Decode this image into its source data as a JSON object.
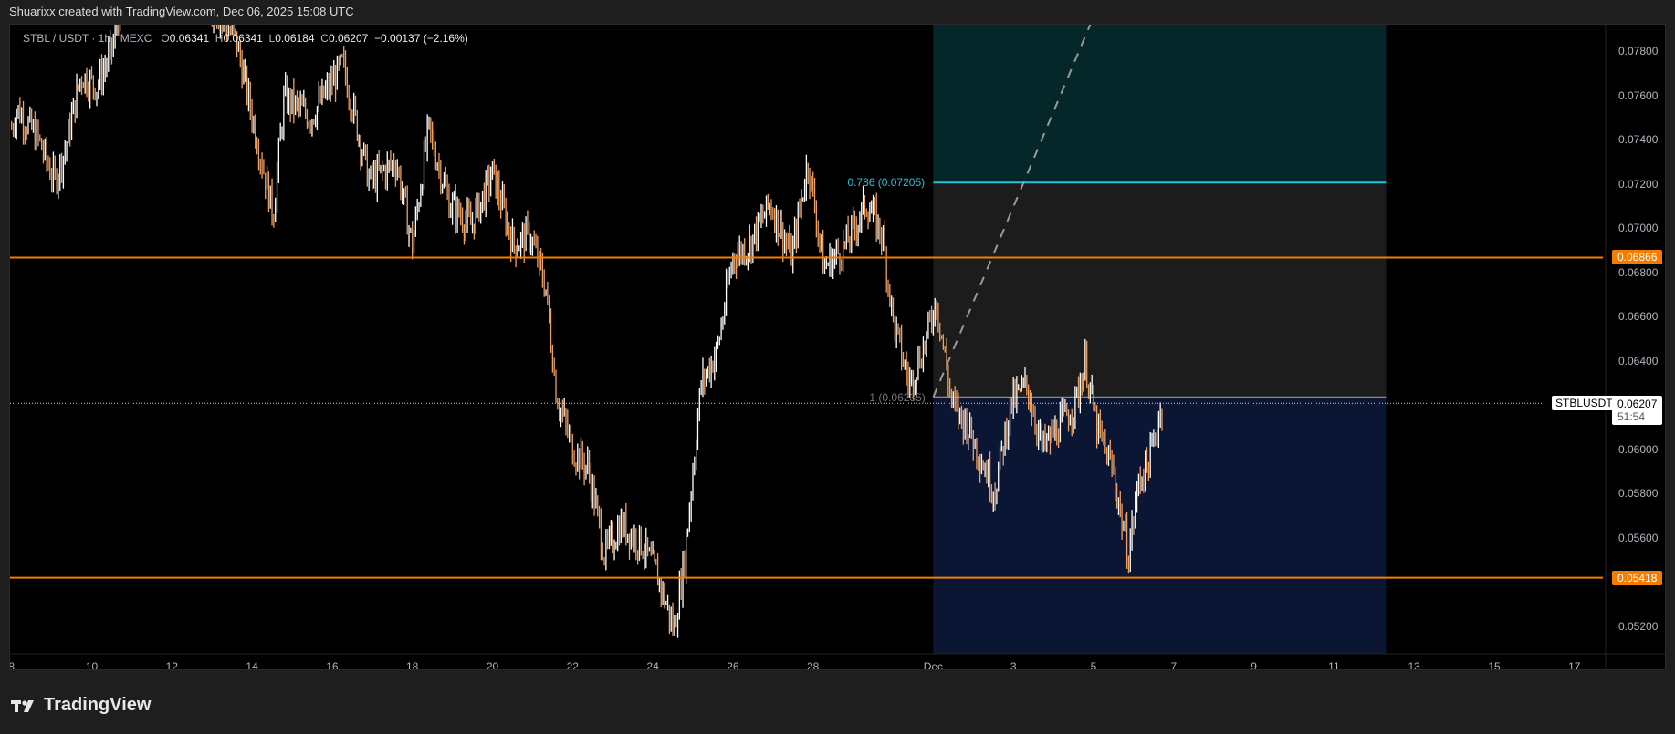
{
  "header": {
    "attribution": "Shuarixx created with TradingView.com, Dec 06, 2025 15:08 UTC"
  },
  "legend": {
    "symbol": "STBL / USDT · 1h · MEXC",
    "open_label": "O",
    "open": "0.06341",
    "high_label": "H",
    "high": "0.06341",
    "low_label": "L",
    "low": "0.06184",
    "close_label": "C",
    "close": "0.06207",
    "change": "−0.00137 (−2.16%)"
  },
  "price_axis": {
    "ticks": [
      "0.07800",
      "0.07600",
      "0.07400",
      "0.07200",
      "0.07000",
      "0.06800",
      "0.06600",
      "0.06400",
      "0.06000",
      "0.05800",
      "0.05600",
      "0.05200"
    ],
    "levels": [
      {
        "label": "0.06866",
        "value": 0.06866
      },
      {
        "label": "0.05418",
        "value": 0.05418
      }
    ],
    "current": {
      "symbol": "STBLUSDT",
      "price": "0.06207",
      "value": 0.06207,
      "countdown": "51:54"
    }
  },
  "time_axis": {
    "ticks": [
      "8",
      "10",
      "12",
      "14",
      "16",
      "18",
      "20",
      "22",
      "24",
      "26",
      "28",
      "Dec",
      "3",
      "5",
      "7",
      "9",
      "11",
      "13",
      "15",
      "17"
    ]
  },
  "fib_tool": {
    "level_786": {
      "label": "0.786 (0.07205)",
      "value": 0.07205
    },
    "level_1": {
      "label": "1 (0.06235)",
      "value": 0.06235
    },
    "start_day": 23.0,
    "end_day": 34.3
  },
  "colors": {
    "up": "#ffffff",
    "down": "#f0a060",
    "level": "#f57c00",
    "fib": "#22c3d6",
    "bg": "#000000"
  },
  "chart_data": {
    "type": "line",
    "title": "STBL / USDT · 1h · MEXC",
    "x_unit": "days since Nov 8, 2025",
    "ylim": [
      0.0505,
      0.0792
    ],
    "keypoints": [
      [
        0,
        0.0745
      ],
      [
        0.13,
        0.0754
      ],
      [
        0.67,
        0.074
      ],
      [
        1.07,
        0.0721
      ],
      [
        1.33,
        0.0735
      ],
      [
        1.73,
        0.0769
      ],
      [
        2.13,
        0.0764
      ],
      [
        2.53,
        0.0782
      ],
      [
        2.8,
        0.081
      ],
      [
        4.2,
        0.082
      ],
      [
        5.6,
        0.0785
      ],
      [
        6.13,
        0.074
      ],
      [
        6.53,
        0.0706
      ],
      [
        6.8,
        0.0759
      ],
      [
        7.47,
        0.075
      ],
      [
        8.27,
        0.0774
      ],
      [
        8.93,
        0.0721
      ],
      [
        9.6,
        0.073
      ],
      [
        10.0,
        0.0692
      ],
      [
        10.4,
        0.0745
      ],
      [
        10.93,
        0.0711
      ],
      [
        11.47,
        0.0701
      ],
      [
        12.0,
        0.0725
      ],
      [
        12.53,
        0.0692
      ],
      [
        12.93,
        0.0697
      ],
      [
        13.33,
        0.0673
      ],
      [
        13.6,
        0.0624
      ],
      [
        14.0,
        0.06
      ],
      [
        14.4,
        0.0591
      ],
      [
        14.8,
        0.0552
      ],
      [
        15.2,
        0.0566
      ],
      [
        15.73,
        0.0557
      ],
      [
        16.13,
        0.0542
      ],
      [
        16.53,
        0.0518
      ],
      [
        16.8,
        0.0552
      ],
      [
        17.2,
        0.0629
      ],
      [
        17.6,
        0.0644
      ],
      [
        18.0,
        0.0687
      ],
      [
        18.4,
        0.0692
      ],
      [
        18.93,
        0.0711
      ],
      [
        19.47,
        0.0687
      ],
      [
        19.87,
        0.073
      ],
      [
        20.27,
        0.0682
      ],
      [
        20.8,
        0.0692
      ],
      [
        21.33,
        0.0711
      ],
      [
        21.73,
        0.0697
      ],
      [
        22.0,
        0.0658
      ],
      [
        22.4,
        0.0629
      ],
      [
        22.8,
        0.0648
      ],
      [
        23.07,
        0.0668
      ],
      [
        23.47,
        0.062
      ],
      [
        23.87,
        0.061
      ],
      [
        24.53,
        0.0581
      ],
      [
        24.93,
        0.062
      ],
      [
        25.33,
        0.0629
      ],
      [
        25.73,
        0.06
      ],
      [
        26.13,
        0.061
      ],
      [
        26.53,
        0.062
      ],
      [
        26.8,
        0.0639
      ],
      [
        27.07,
        0.061
      ],
      [
        27.47,
        0.0591
      ],
      [
        27.87,
        0.0552
      ],
      [
        28.13,
        0.0586
      ],
      [
        28.4,
        0.0595
      ],
      [
        28.72,
        0.0621
      ]
    ]
  }
}
